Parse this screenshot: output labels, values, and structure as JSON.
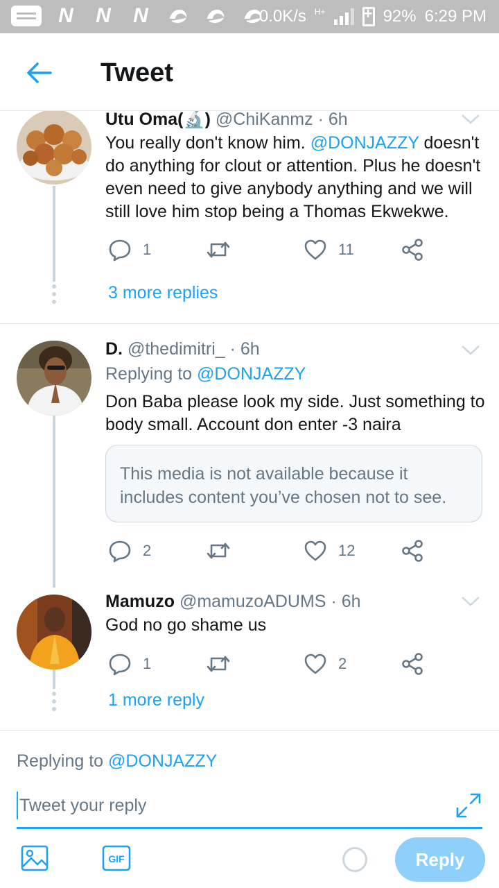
{
  "status_bar": {
    "speed": "0.0K/s",
    "network": "H+",
    "battery": "92%",
    "time": "6:29 PM"
  },
  "header": {
    "title": "Tweet"
  },
  "tweets": [
    {
      "name": "Utu Oma(🔬)",
      "handle": "@ChiKanmz",
      "time": "6h",
      "text_before": "You really don't know him. ",
      "mention": "@DONJAZZY",
      "text_after": " doesn't do anything for clout or attention. Plus he doesn't even need to give anybody anything and we will still love him stop being a Thomas Ekwekwe.",
      "replies": "1",
      "retweets": "",
      "likes": "11",
      "more_replies": "3 more replies"
    },
    {
      "name": "D.",
      "handle": "@thedimitri_",
      "time": "6h",
      "replying_label": "Replying to ",
      "replying_to": "@DONJAZZY",
      "text": "Don Baba please look my side. Just something to body small. Account don enter -3 naira",
      "media_notice": "This media is not available because it includes content you’ve chosen not to see.",
      "replies": "2",
      "retweets": "",
      "likes": "12"
    },
    {
      "name": "Mamuzo",
      "handle": "@mamuzoADUMS",
      "time": "6h",
      "text": "God no go shame us",
      "replies": "1",
      "retweets": "",
      "likes": "2",
      "more_replies": "1 more reply"
    }
  ],
  "composer": {
    "replying_label": "Replying to ",
    "replying_to": "@DONJAZZY",
    "placeholder": "Tweet your reply",
    "gif_label": "GIF",
    "reply_button": "Reply"
  },
  "colors": {
    "accent": "#1da1f2",
    "muted": "#657786",
    "reply_disabled": "#8ed0f9"
  }
}
